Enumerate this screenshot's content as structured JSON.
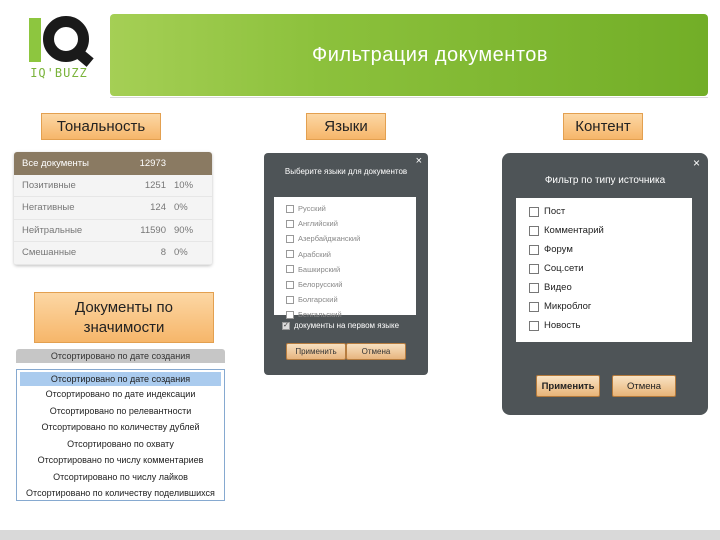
{
  "logo": {
    "text": "IQ'BUZZ"
  },
  "header": {
    "title": "Фильтрация документов"
  },
  "labels": {
    "tonality": "Тональность",
    "languages": "Языки",
    "content": "Контент",
    "importance": "Документы по значимости"
  },
  "tonality_table": {
    "rows": [
      {
        "name": "Все документы",
        "count": "12973",
        "percent": ""
      },
      {
        "name": "Позитивные",
        "count": "1251",
        "percent": "10%"
      },
      {
        "name": "Негативные",
        "count": "124",
        "percent": "0%"
      },
      {
        "name": "Нейтральные",
        "count": "11590",
        "percent": "90%"
      },
      {
        "name": "Смешанные",
        "count": "8",
        "percent": "0%"
      }
    ]
  },
  "sort_dropdown": {
    "selected": "Отсортировано по дате создания",
    "options": [
      "Отсортировано по дате создания",
      "Отсортировано по дате индексации",
      "Отсортировано по релевантности",
      "Отсортировано по количеству дублей",
      "Отсортировано по охвату",
      "Отсортировано по числу комментариев",
      "Отсортировано по числу лайков",
      "Отсортировано по количеству поделившихся"
    ]
  },
  "languages_dialog": {
    "title": "Выберите языки для документов",
    "close": "×",
    "languages": [
      "Русский",
      "Английский",
      "Азербайджанский",
      "Арабский",
      "Башкирский",
      "Белорусский",
      "Болгарский",
      "Бенгальский"
    ],
    "first_language_option": "документы на первом языке",
    "first_language_checked": true,
    "apply": "Применить",
    "cancel": "Отмена"
  },
  "content_dialog": {
    "title": "Фильтр по типу источника",
    "close": "×",
    "types": [
      "Пост",
      "Комментарий",
      "Форум",
      "Соц.сети",
      "Видео",
      "Микроблог",
      "Новость"
    ],
    "apply": "Применить",
    "cancel": "Отмена"
  }
}
